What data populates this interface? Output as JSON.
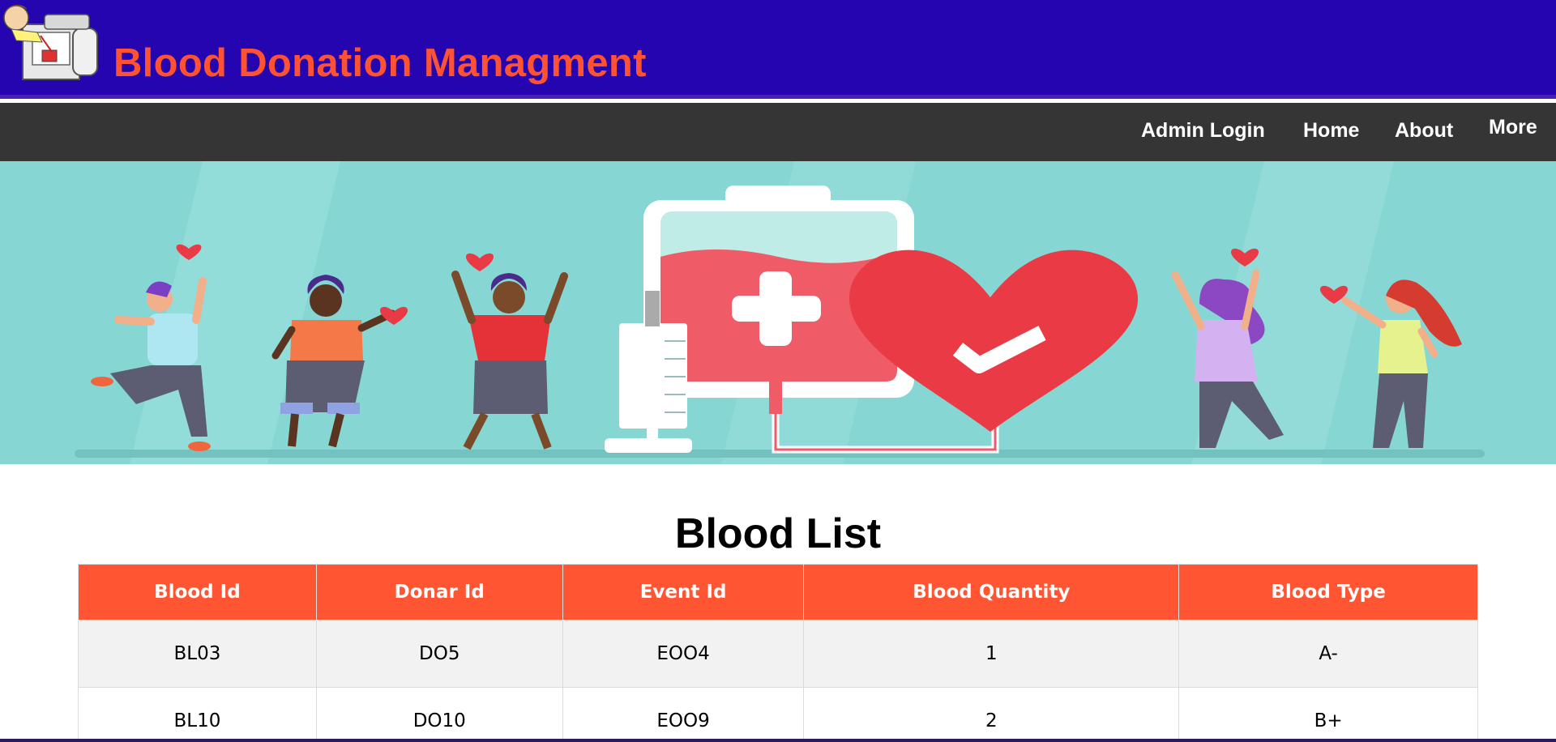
{
  "header": {
    "title": "Blood Donation Managment",
    "logo": "blood-donation-cartoon-logo",
    "background": "#2505b0",
    "title_color": "#ff5233"
  },
  "nav": {
    "items": [
      {
        "label": "Admin Login"
      },
      {
        "label": "Home"
      },
      {
        "label": "About"
      },
      {
        "label": "More"
      }
    ]
  },
  "banner": {
    "image": "blood-donation-illustration",
    "background": "#86d7d4"
  },
  "blood_list": {
    "title": "Blood List",
    "columns": [
      "Blood Id",
      "Donar Id",
      "Event Id",
      "Blood Quantity",
      "Blood Type"
    ],
    "rows": [
      [
        "BL03",
        "DO5",
        "EOO4",
        "1",
        "A-"
      ],
      [
        "BL10",
        "DO10",
        "EOO9",
        "2",
        "B+"
      ]
    ],
    "header_color": "#ff5533"
  }
}
